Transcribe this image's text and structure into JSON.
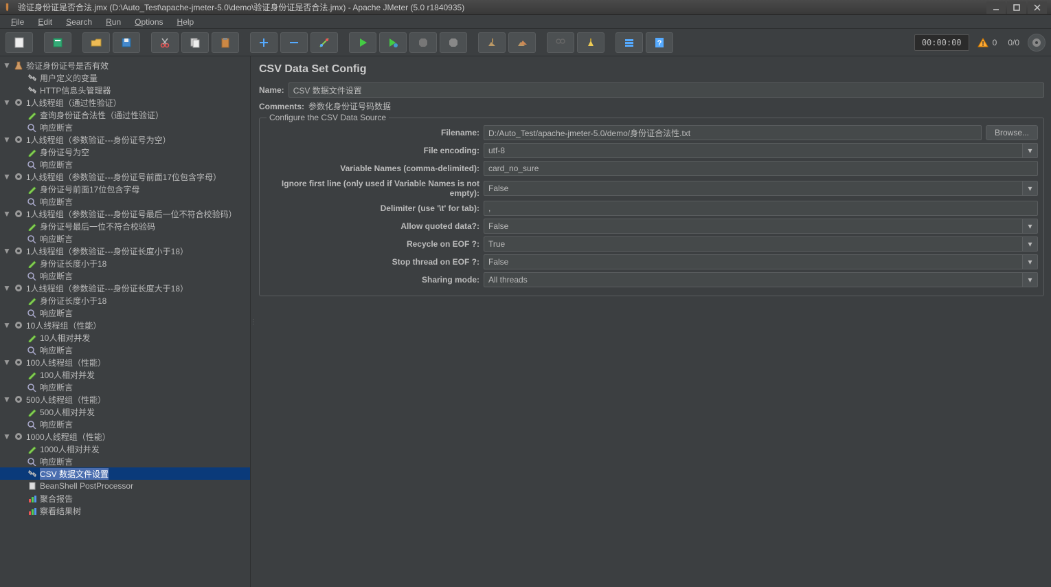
{
  "window": {
    "title": "验证身份证是否合法.jmx (D:\\Auto_Test\\apache-jmeter-5.0\\demo\\验证身份证是否合法.jmx) - Apache JMeter (5.0 r1840935)"
  },
  "menu": {
    "file": "File",
    "edit": "Edit",
    "search": "Search",
    "run": "Run",
    "options": "Options",
    "help": "Help"
  },
  "toolbar": {
    "timer": "00:00:00",
    "warn_count": "0",
    "thread_ratio": "0/0"
  },
  "tree": [
    {
      "indent": 0,
      "expand": true,
      "icon": "flask",
      "label": "验证身份证号是否有效"
    },
    {
      "indent": 1,
      "expand": null,
      "icon": "wrench",
      "label": "用户定义的变量"
    },
    {
      "indent": 1,
      "expand": null,
      "icon": "wrench",
      "label": "HTTP信息头管理器"
    },
    {
      "indent": 0,
      "expand": true,
      "icon": "gear",
      "label": "1人线程组（通过性验证）"
    },
    {
      "indent": 1,
      "expand": null,
      "icon": "pencil",
      "label": "查询身份证合法性（通过性验证）"
    },
    {
      "indent": 1,
      "expand": null,
      "icon": "assert",
      "label": "响应断言"
    },
    {
      "indent": 0,
      "expand": true,
      "icon": "gear",
      "label": "1人线程组（参数验证---身份证号为空）"
    },
    {
      "indent": 1,
      "expand": null,
      "icon": "pencil",
      "label": "身份证号为空"
    },
    {
      "indent": 1,
      "expand": null,
      "icon": "assert",
      "label": "响应断言"
    },
    {
      "indent": 0,
      "expand": true,
      "icon": "gear",
      "label": "1人线程组（参数验证---身份证号前面17位包含字母）"
    },
    {
      "indent": 1,
      "expand": null,
      "icon": "pencil",
      "label": "身份证号前面17位包含字母"
    },
    {
      "indent": 1,
      "expand": null,
      "icon": "assert",
      "label": "响应断言"
    },
    {
      "indent": 0,
      "expand": true,
      "icon": "gear",
      "label": "1人线程组（参数验证---身份证号最后一位不符合校验码）"
    },
    {
      "indent": 1,
      "expand": null,
      "icon": "pencil",
      "label": "身份证号最后一位不符合校验码"
    },
    {
      "indent": 1,
      "expand": null,
      "icon": "assert",
      "label": "响应断言"
    },
    {
      "indent": 0,
      "expand": true,
      "icon": "gear",
      "label": "1人线程组（参数验证---身份证长度小于18）"
    },
    {
      "indent": 1,
      "expand": null,
      "icon": "pencil",
      "label": "身份证长度小于18"
    },
    {
      "indent": 1,
      "expand": null,
      "icon": "assert",
      "label": "响应断言"
    },
    {
      "indent": 0,
      "expand": true,
      "icon": "gear",
      "label": "1人线程组（参数验证---身份证长度大于18）"
    },
    {
      "indent": 1,
      "expand": null,
      "icon": "pencil",
      "label": "身份证长度小于18"
    },
    {
      "indent": 1,
      "expand": null,
      "icon": "assert",
      "label": "响应断言"
    },
    {
      "indent": 0,
      "expand": true,
      "icon": "gear",
      "label": "10人线程组（性能）"
    },
    {
      "indent": 1,
      "expand": null,
      "icon": "pencil",
      "label": "10人相对并发"
    },
    {
      "indent": 1,
      "expand": null,
      "icon": "assert",
      "label": "响应断言"
    },
    {
      "indent": 0,
      "expand": true,
      "icon": "gear",
      "label": "100人线程组（性能）"
    },
    {
      "indent": 1,
      "expand": null,
      "icon": "pencil",
      "label": "100人相对并发"
    },
    {
      "indent": 1,
      "expand": null,
      "icon": "assert",
      "label": "响应断言"
    },
    {
      "indent": 0,
      "expand": true,
      "icon": "gear",
      "label": "500人线程组（性能）"
    },
    {
      "indent": 1,
      "expand": null,
      "icon": "pencil",
      "label": "500人相对并发"
    },
    {
      "indent": 1,
      "expand": null,
      "icon": "assert",
      "label": "响应断言"
    },
    {
      "indent": 0,
      "expand": true,
      "icon": "gear",
      "label": "1000人线程组（性能）"
    },
    {
      "indent": 1,
      "expand": null,
      "icon": "pencil",
      "label": "1000人相对并发"
    },
    {
      "indent": 1,
      "expand": null,
      "icon": "assert",
      "label": "响应断言"
    },
    {
      "indent": 1,
      "expand": null,
      "icon": "wrench",
      "label": "CSV 数据文件设置",
      "selected": true
    },
    {
      "indent": 1,
      "expand": null,
      "icon": "doc",
      "label": "BeanShell PostProcessor"
    },
    {
      "indent": 1,
      "expand": null,
      "icon": "report",
      "label": "聚合报告"
    },
    {
      "indent": 1,
      "expand": null,
      "icon": "report",
      "label": "察看结果树"
    }
  ],
  "editor": {
    "title": "CSV Data Set Config",
    "name_label": "Name:",
    "name_value": "CSV 数据文件设置",
    "comments_label": "Comments:",
    "comments_value": "参数化身份证号码数据",
    "box_title": "Configure the CSV Data Source",
    "fields": {
      "filename": {
        "label": "Filename:",
        "value": "D:/Auto_Test/apache-jmeter-5.0/demo/身份证合法性.txt",
        "browse": "Browse..."
      },
      "encoding": {
        "label": "File encoding:",
        "value": "utf-8"
      },
      "varnames": {
        "label": "Variable Names (comma-delimited):",
        "value": "card_no_sure"
      },
      "ignore": {
        "label": "Ignore first line (only used if Variable Names is not empty):",
        "value": "False"
      },
      "delimiter": {
        "label": "Delimiter (use '\\t' for tab):",
        "value": ","
      },
      "quoted": {
        "label": "Allow quoted data?:",
        "value": "False"
      },
      "recycle": {
        "label": "Recycle on EOF ?:",
        "value": "True"
      },
      "stop": {
        "label": "Stop thread on EOF ?:",
        "value": "False"
      },
      "sharing": {
        "label": "Sharing mode:",
        "value": "All threads"
      }
    }
  }
}
